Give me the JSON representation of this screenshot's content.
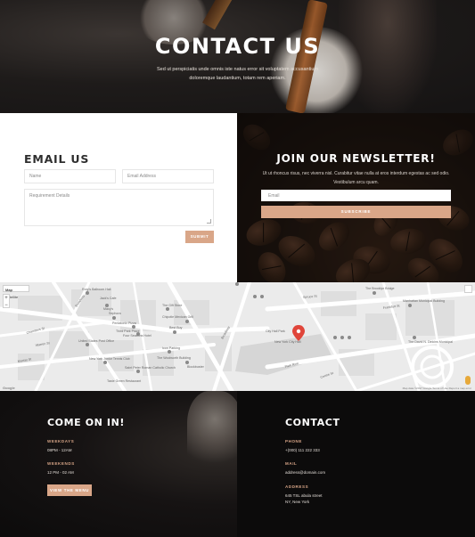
{
  "hero": {
    "title": "CONTACT US",
    "subtitle_line1": "Sed ut perspiciatis unde omnis iste natus error sit voluptatem accusantium",
    "subtitle_line2": "doloremque laudantium, totam rem aperiam."
  },
  "email_form": {
    "heading": "EMAIL US",
    "name_placeholder": "Name",
    "email_placeholder": "Email Address",
    "details_placeholder": "Requirement Details",
    "submit_label": "SUBMIT"
  },
  "newsletter": {
    "heading": "JOIN OUR NEWSLETTER!",
    "text_line1": "Ut ut rhoncus risus, nec viverra nisl. Curabitur vitae nulla at eros interdum egestas ac sed odio.",
    "text_line2": "Vestibulum arcu quam.",
    "email_placeholder": "Email",
    "subscribe_label": "SUBSCRIBE"
  },
  "map": {
    "type_options": [
      "Map",
      "Satellite"
    ],
    "zoom_in": "+",
    "zoom_out": "−",
    "google_label": "Google",
    "credit_text": "Map data ©2017 Google   Terms of Use   Report a map error",
    "pin_color": "#e0453a",
    "places": [
      {
        "name": "Rory's Ballroom Hall"
      },
      {
        "name": "Jack's Cafe"
      },
      {
        "name": "Macy's"
      },
      {
        "name": "Sephora"
      },
      {
        "name": "The Gift Store"
      },
      {
        "name": "Chipotle Mexican Grill"
      },
      {
        "name": "Best Buy"
      },
      {
        "name": "Pentatonix Pizza"
      },
      {
        "name": "Third Park Place"
      },
      {
        "name": "Four Seasons Hotel New York Downtown"
      },
      {
        "name": "United States Post Office"
      },
      {
        "name": "New York Junior Tennis Club"
      },
      {
        "name": "Icon Parking"
      },
      {
        "name": "The Woolworth Building"
      },
      {
        "name": "Saint Peter Roman Catholic Church"
      },
      {
        "name": "Blockbuster"
      },
      {
        "name": "Taste Green Restaurant Tribeca Bar"
      },
      {
        "name": "City Hall Park"
      },
      {
        "name": "New York City Hall"
      },
      {
        "name": "The Brooklyn Bridge"
      },
      {
        "name": "Manhattan Municipal Building"
      },
      {
        "name": "The David N. Dinkins Municipal"
      }
    ],
    "streets": [
      "Broadway",
      "Park Row",
      "Chambers St",
      "Centre St",
      "Murray St",
      "Warren St",
      "Frankfort St",
      "Spruce St"
    ]
  },
  "come_on_in": {
    "heading": "COME ON IN!",
    "weekdays_label": "WEEKDAYS",
    "weekdays_hours": "08PM - 12AM",
    "weekends_label": "WEEKENDS",
    "weekends_hours": "12 PM - 02 AM",
    "menu_button": "VIEW THE MENU"
  },
  "contact": {
    "heading": "CONTACT",
    "phone_label": "PHONE",
    "phone_value": "+(000) 111 222 333",
    "mail_label": "MAIL",
    "mail_value": "address@domain.com",
    "address_label": "ADDRESS",
    "address_line1": "645 TSL abula street",
    "address_line2": "NY, New York"
  },
  "colors": {
    "accent": "#d9a688",
    "dark_bg": "#0c0b0b",
    "white": "#ffffff"
  }
}
